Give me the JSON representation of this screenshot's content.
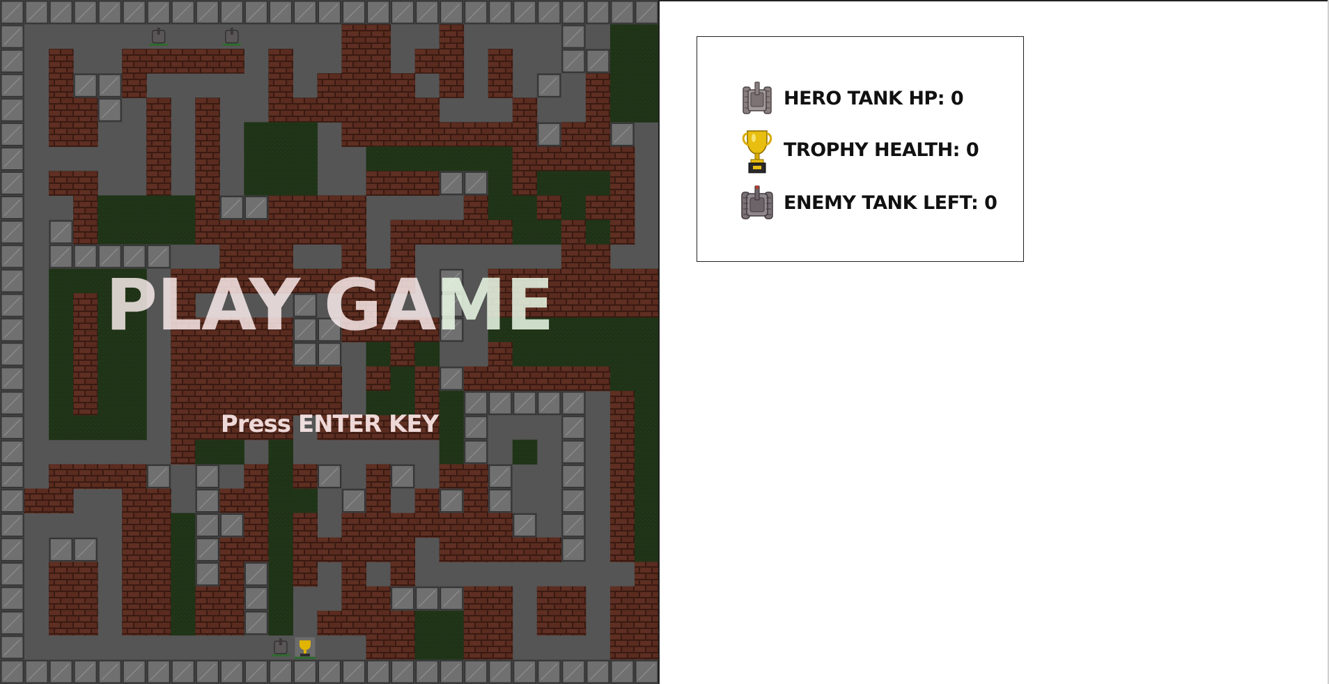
{
  "game": {
    "title_part1": "PLAY GA",
    "title_part2": "ME",
    "prompt": "Press ENTER KEY"
  },
  "status": {
    "hero_hp_label": "HERO TANK HP: 0",
    "trophy_health_label": "TROPHY HEALTH: 0",
    "enemy_left_label": "ENEMY TANK LEFT: 0"
  },
  "icons": {
    "hero": "hero-tank-icon",
    "trophy": "trophy-icon",
    "enemy": "enemy-tank-icon"
  },
  "colors": {
    "floor": "#555555",
    "brick": "#5a2d20",
    "mortar": "#3a1a12",
    "steel": "#6a6a6a",
    "grass": "#1f3317",
    "border": "#3c3c3c",
    "trophy_gold": "#e0b400"
  },
  "map": {
    "cols": 27,
    "rows": 28,
    "legend": "S=steel wall, B=brick wall, G=grass bush, .=floor",
    "grid": [
      "SSSSSSSSSSSSSSSSSSSSSSSSSSS",
      "S.....?..?....BB..B....S.GGS",
      "S.B..BBBBB.B..BB.BB.B..SSGGS",
      "S.BSSB.....B.BBBB.B.B.S.BGGS",
      "S.BBS.B.B..BBBBBBB...B..BGGS",
      "S.BB..B.B.GGG.BBBBBBBBSBBS.S",
      "S.....B.B.GGG..GGGGGGBBBBB.S",
      "S.BB..B.B.GGG..BBBSSGBGGGB.S",
      "S..BGGGGBSSBBBB....BGGBGBB.S",
      "S.SBGGGGBBBBBBB.BBBBBGGBGB.S",
      "S.SSSSS..BBB..B.B......BB..S",
      "S.GGGG.BBBBBBBBBB.S.BBBBBBBS",
      "S.GBGG.B....S.BB..S.BBBBBBBS",
      "S.GBGG.BBBBBSSBBBBS.GGGGGGGS",
      "S.GBGG.BBBBBSS.GBG..BGGGGGGS",
      "S.GBGG.BBBBBBB.BGBSBBBBBBGGS",
      "S.GBGG.BBBBBBB.GGBGSSSSS.BGS",
      "S.GGGG.BBBBB.BBBBBGS...S.BGS",
      "S......BGG.G......GS.G.S.BGS",
      "S.BBBBS.S.BGBS.BS.BBS..S.BGS",
      "SBB..BB.SBBGG.SB.BSBS..S.BGS",
      "S....BBGSSBGB.BBBBBBBS.S.BGS",
      "S.SS.BBGSBBGBBBBB.BBBBBS.BGS",
      "S.BB.BBGSBSGB.B.B.........BGS",
      "S.BB.BBGBBSG..BBSSSBB.BB.BBS",
      "S.BB.BBGBBSG.BBBBGGBB.BB.BBS",
      "S..........HT..BBGGBB....BBS",
      "SSSSSSSSSSSSSSSSSSSSSSSSSSS"
    ]
  }
}
